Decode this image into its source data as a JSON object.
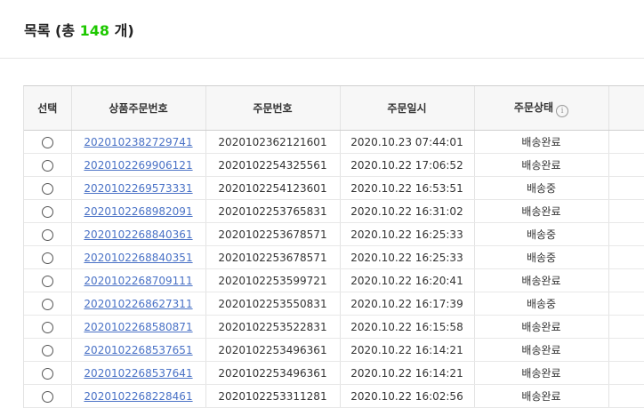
{
  "header": {
    "title_prefix": "목록 (총 ",
    "count": "148",
    "title_suffix": " 개)"
  },
  "table": {
    "columns": [
      "선택",
      "상품주문번호",
      "주문번호",
      "주문일시",
      "주문상태",
      ""
    ],
    "status_info_icon": "info-icon",
    "rows": [
      {
        "product_order_no": "2020102382729741",
        "order_no": "2020102362121601",
        "ordered_at": "2020.10.23 07:44:01",
        "status": "배송완료"
      },
      {
        "product_order_no": "2020102269906121",
        "order_no": "2020102254325561",
        "ordered_at": "2020.10.22 17:06:52",
        "status": "배송완료"
      },
      {
        "product_order_no": "2020102269573331",
        "order_no": "2020102254123601",
        "ordered_at": "2020.10.22 16:53:51",
        "status": "배송중"
      },
      {
        "product_order_no": "2020102268982091",
        "order_no": "2020102253765831",
        "ordered_at": "2020.10.22 16:31:02",
        "status": "배송완료"
      },
      {
        "product_order_no": "2020102268840361",
        "order_no": "2020102253678571",
        "ordered_at": "2020.10.22 16:25:33",
        "status": "배송중"
      },
      {
        "product_order_no": "2020102268840351",
        "order_no": "2020102253678571",
        "ordered_at": "2020.10.22 16:25:33",
        "status": "배송중"
      },
      {
        "product_order_no": "2020102268709111",
        "order_no": "2020102253599721",
        "ordered_at": "2020.10.22 16:20:41",
        "status": "배송완료"
      },
      {
        "product_order_no": "2020102268627311",
        "order_no": "2020102253550831",
        "ordered_at": "2020.10.22 16:17:39",
        "status": "배송중"
      },
      {
        "product_order_no": "2020102268580871",
        "order_no": "2020102253522831",
        "ordered_at": "2020.10.22 16:15:58",
        "status": "배송완료"
      },
      {
        "product_order_no": "2020102268537651",
        "order_no": "2020102253496361",
        "ordered_at": "2020.10.22 16:14:21",
        "status": "배송완료"
      },
      {
        "product_order_no": "2020102268537641",
        "order_no": "2020102253496361",
        "ordered_at": "2020.10.22 16:14:21",
        "status": "배송완료"
      },
      {
        "product_order_no": "2020102268228461",
        "order_no": "2020102253311281",
        "ordered_at": "2020.10.22 16:02:56",
        "status": "배송완료"
      }
    ]
  }
}
